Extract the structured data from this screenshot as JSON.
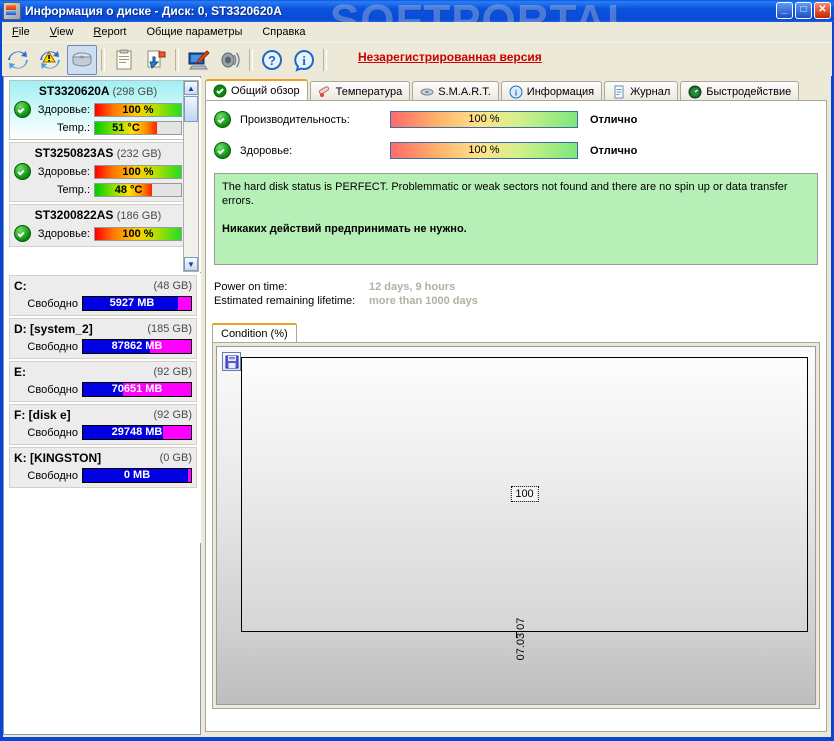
{
  "window": {
    "title": "Информация о диске - Диск: 0, ST3320620A",
    "icon": "disk-info-icon",
    "minimize_label": "_",
    "maximize_label": "□",
    "close_label": "✕"
  },
  "watermark": {
    "big": "SOFTPORTAL",
    "small": "www.softportal.com"
  },
  "menubar": {
    "items": [
      {
        "label": "File",
        "accel": "F"
      },
      {
        "label": "View",
        "accel": "V"
      },
      {
        "label": "Report",
        "accel": "R"
      },
      {
        "label": "Общие параметры",
        "accel": ""
      },
      {
        "label": "Справка",
        "accel": ""
      }
    ]
  },
  "toolbar": {
    "buttons": [
      {
        "name": "refresh-icon",
        "title": "Refresh"
      },
      {
        "name": "refresh-warning-icon",
        "title": "Refresh with warning"
      },
      {
        "name": "disk-icon",
        "title": "Disk",
        "pressed": true
      },
      {
        "name": "report-icon",
        "title": "Report"
      },
      {
        "name": "export-report-icon",
        "title": "Export report"
      },
      {
        "name": "monitor-edit-icon",
        "title": "Settings"
      },
      {
        "name": "speaker-icon",
        "title": "Sound"
      },
      {
        "name": "help-icon",
        "title": "Help"
      },
      {
        "name": "info-icon",
        "title": "Information"
      }
    ],
    "unregistered_label": "Незарегистрированная версия"
  },
  "drives": [
    {
      "model": "ST3320620A",
      "capacity": "(298 GB)",
      "selected": true,
      "status_icon": "ok-check-icon",
      "health_label": "Здоровье:",
      "health_value": "100 %",
      "health_percent": 100,
      "temp_label": "Temp.:",
      "temp_value": "51 °C",
      "temp_percent": 72
    },
    {
      "model": "ST3250823AS",
      "capacity": "(232 GB)",
      "selected": false,
      "status_icon": "ok-check-icon",
      "health_label": "Здоровье:",
      "health_value": "100 %",
      "health_percent": 100,
      "temp_label": "Temp.:",
      "temp_value": "48 °C",
      "temp_percent": 66
    },
    {
      "model": "ST3200822AS",
      "capacity": "(186 GB)",
      "selected": false,
      "status_icon": "ok-check-icon",
      "health_label": "Здоровье:",
      "health_value": "100 %",
      "health_percent": 100,
      "temp_label": "",
      "temp_value": "",
      "temp_percent": 0
    }
  ],
  "volumes": [
    {
      "name": "C:",
      "capacity": "(48 GB)",
      "free_label": "Свободно",
      "free_value": "5927 MB",
      "used_percent": 88
    },
    {
      "name": "D: [system_2]",
      "capacity": "(185 GB)",
      "free_label": "Свободно",
      "free_value": "87862 MB",
      "used_percent": 62
    },
    {
      "name": "E:",
      "capacity": "(92 GB)",
      "free_label": "Свободно",
      "free_value": "70651 MB",
      "used_percent": 37
    },
    {
      "name": "F: [disk e]",
      "capacity": "(92 GB)",
      "free_label": "Свободно",
      "free_value": "29748 MB",
      "used_percent": 74
    },
    {
      "name": "K: [KINGSTON]",
      "capacity": "(0 GB)",
      "free_label": "Свободно",
      "free_value": "0 MB",
      "used_percent": 97
    }
  ],
  "scrollbar": {
    "up": "▲",
    "down": "▼"
  },
  "tabs": [
    {
      "label": "Общий обзор",
      "icon": "ok-check-icon",
      "active": true
    },
    {
      "label": "Температура",
      "icon": "thermometer-icon",
      "active": false
    },
    {
      "label": "S.M.A.R.T.",
      "icon": "smart-icon",
      "active": false
    },
    {
      "label": "Информация",
      "icon": "info-icon",
      "active": false
    },
    {
      "label": "Журнал",
      "icon": "document-icon",
      "active": false
    },
    {
      "label": "Быстродействие",
      "icon": "gauge-icon",
      "active": false
    }
  ],
  "overview": {
    "performance": {
      "icon": "ok-check-icon",
      "label": "Производительность:",
      "value": "100 %",
      "percent": 100,
      "verdict": "Отлично"
    },
    "health": {
      "icon": "ok-check-icon",
      "label": "Здоровье:",
      "value": "100 %",
      "percent": 100,
      "verdict": "Отлично"
    },
    "message_line1": "The hard disk status is PERFECT. Problemmatic or weak sectors not found and there are no spin up or data transfer errors.",
    "message_line2": "Никаких действий предпринимать не нужно.",
    "power_on_label": "Power on time:",
    "power_on_value": "12 days, 9 hours",
    "lifetime_label": "Estimated remaining lifetime:",
    "lifetime_value": "more than 1000 days"
  },
  "chart_panel": {
    "tab_label": "Condition (%)",
    "save_icon": "floppy-save-icon"
  },
  "chart_data": {
    "type": "line",
    "title": "Condition (%)",
    "xlabel": "",
    "ylabel": "",
    "x": [
      "07.03.07"
    ],
    "values": [
      100
    ],
    "point_labels": [
      "100"
    ],
    "ylim": [
      0,
      100
    ],
    "grid": false,
    "legend": false
  },
  "colors": {
    "accent_blue": "#0a46d2",
    "tab_active_top": "#f0a020",
    "ok_green": "#0a8a0a",
    "message_bg": "#b6f0b6",
    "unregistered_red": "#cc0000",
    "volume_used": "#0000e0",
    "volume_free": "#ff00ff"
  }
}
